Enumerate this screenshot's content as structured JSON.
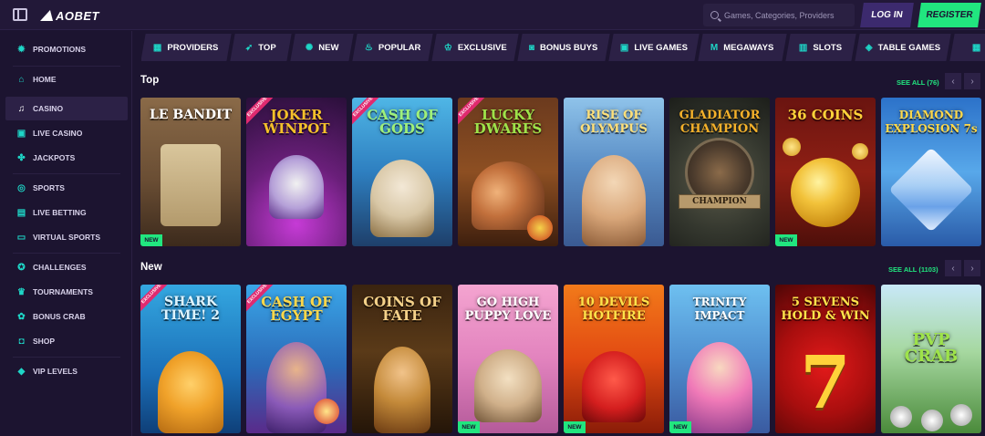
{
  "header": {
    "logo_text": "AOBET",
    "search_placeholder": "Games, Categories, Providers",
    "login_label": "LOG IN",
    "register_label": "REGISTER"
  },
  "sidebar": {
    "items": [
      {
        "label": "PROMOTIONS",
        "icon": "gear-icon"
      },
      {
        "label": "HOME",
        "icon": "home-icon"
      },
      {
        "label": "CASINO",
        "icon": "music-note-icon"
      },
      {
        "label": "LIVE CASINO",
        "icon": "live-cards-icon"
      },
      {
        "label": "JACKPOTS",
        "icon": "clover-icon"
      },
      {
        "label": "SPORTS",
        "icon": "sports-ball-icon"
      },
      {
        "label": "LIVE BETTING",
        "icon": "live-tv-icon"
      },
      {
        "label": "VIRTUAL SPORTS",
        "icon": "screen-icon"
      },
      {
        "label": "CHALLENGES",
        "icon": "medal-icon"
      },
      {
        "label": "TOURNAMENTS",
        "icon": "trophy-icon"
      },
      {
        "label": "BONUS CRAB",
        "icon": "crab-icon"
      },
      {
        "label": "SHOP",
        "icon": "shopping-bag-icon"
      },
      {
        "label": "VIP LEVELS",
        "icon": "diamond-icon"
      }
    ]
  },
  "categories": [
    {
      "label": "PROVIDERS",
      "icon": "grid-icon"
    },
    {
      "label": "TOP",
      "icon": "rocket-icon"
    },
    {
      "label": "NEW",
      "icon": "sparkle-icon"
    },
    {
      "label": "POPULAR",
      "icon": "flame-icon"
    },
    {
      "label": "EXCLUSIVE",
      "icon": "crown-icon"
    },
    {
      "label": "BONUS BUYS",
      "icon": "bag-icon"
    },
    {
      "label": "LIVE GAMES",
      "icon": "live-icon"
    },
    {
      "label": "MEGAWAYS",
      "icon": "m-icon"
    },
    {
      "label": "SLOTS",
      "icon": "slot-icon"
    },
    {
      "label": "TABLE GAMES",
      "icon": "layers-icon"
    }
  ],
  "sections": {
    "top": {
      "title": "Top",
      "see_all": "SEE ALL (76)",
      "games": [
        {
          "name": "LE BANDIT",
          "ribbon": "",
          "badge": "NEW"
        },
        {
          "name": "JOKER WINPOT",
          "ribbon": "EXCLUSIVE",
          "badge": ""
        },
        {
          "name": "CASH OF GODS",
          "ribbon": "EXCLUSIVE",
          "badge": ""
        },
        {
          "name": "LUCKY DWARFS",
          "ribbon": "EXCLUSIVE",
          "badge": ""
        },
        {
          "name": "RISE OF OLYMPUS",
          "ribbon": "",
          "badge": ""
        },
        {
          "name": "GLADIATOR CHAMPION",
          "ribbon": "",
          "badge": ""
        },
        {
          "name": "36 COINS",
          "ribbon": "",
          "badge": "NEW"
        },
        {
          "name": "DIAMOND EXPLOSION 7s",
          "ribbon": "",
          "badge": ""
        }
      ]
    },
    "new": {
      "title": "New",
      "see_all": "SEE ALL (1103)",
      "games": [
        {
          "name": "SHARK TIME! 2",
          "ribbon": "EXCLUSIVE",
          "badge": ""
        },
        {
          "name": "CASH OF EGYPT",
          "ribbon": "EXCLUSIVE",
          "badge": ""
        },
        {
          "name": "COINS OF FATE",
          "ribbon": "",
          "badge": ""
        },
        {
          "name": "GO HIGH PUPPY LOVE",
          "ribbon": "",
          "badge": "NEW"
        },
        {
          "name": "10 DEVILS HOTFIRE",
          "ribbon": "",
          "badge": "NEW"
        },
        {
          "name": "TRINITY IMPACT",
          "ribbon": "",
          "badge": "NEW"
        },
        {
          "name": "5 SEVENS HOLD & WIN",
          "ribbon": "",
          "badge": ""
        },
        {
          "name": "PVP CRAB",
          "ribbon": "",
          "badge": ""
        }
      ]
    }
  },
  "colors": {
    "accent_green": "#21e67f",
    "accent_teal": "#1ed6c7",
    "background": "#1c1430",
    "panel": "#2c2146",
    "exclusive_ribbon": "#e02a6f"
  }
}
